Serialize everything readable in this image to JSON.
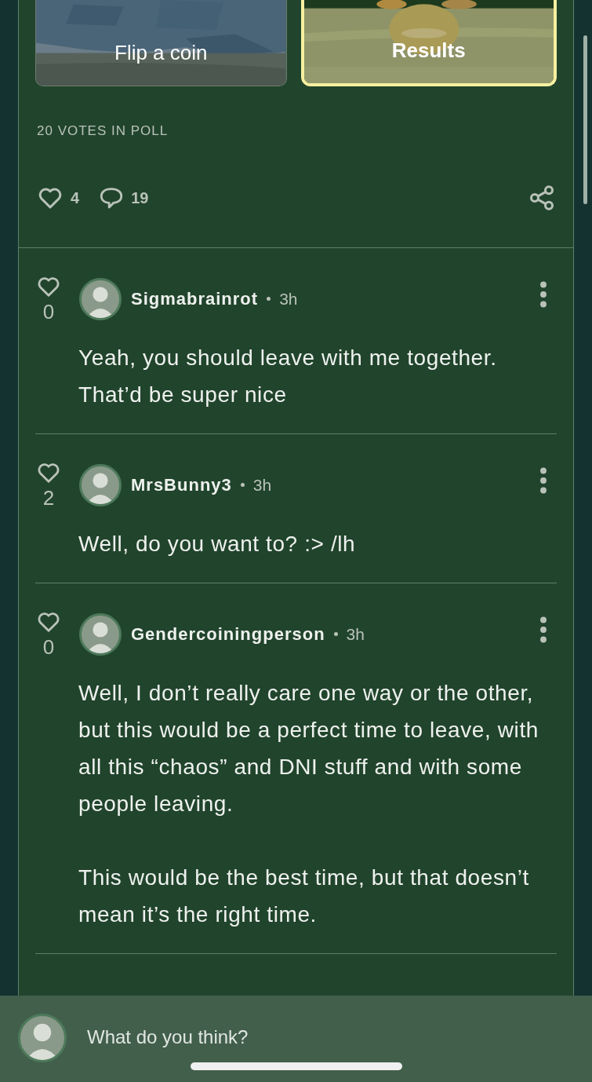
{
  "poll_options": [
    {
      "label": "Flip a coin",
      "selected": false,
      "kind": "map"
    },
    {
      "label": "Results",
      "selected": true,
      "kind": "field"
    }
  ],
  "votes": "20 VOTES IN POLL",
  "actions": {
    "likes": "4",
    "comments": "19"
  },
  "comments": [
    {
      "likes": "0",
      "author": "Sigmabrainrot",
      "time": "3h",
      "paragraphs": [
        "Yeah, you should leave with me together. That’d be super nice"
      ]
    },
    {
      "likes": "2",
      "author": "MrsBunny3",
      "time": "3h",
      "paragraphs": [
        "Well, do you want to? :> /lh"
      ]
    },
    {
      "likes": "0",
      "author": "Gendercoiningperson",
      "time": "3h",
      "paragraphs": [
        "Well, I don’t really care one way or the other, but this would be a perfect time to leave, with all this “chaos” and DNI stuff and with some people leaving.",
        "This would be the best time, but that doesn’t mean it’s the right time."
      ]
    }
  ],
  "composer": {
    "placeholder": "What do you think?"
  }
}
